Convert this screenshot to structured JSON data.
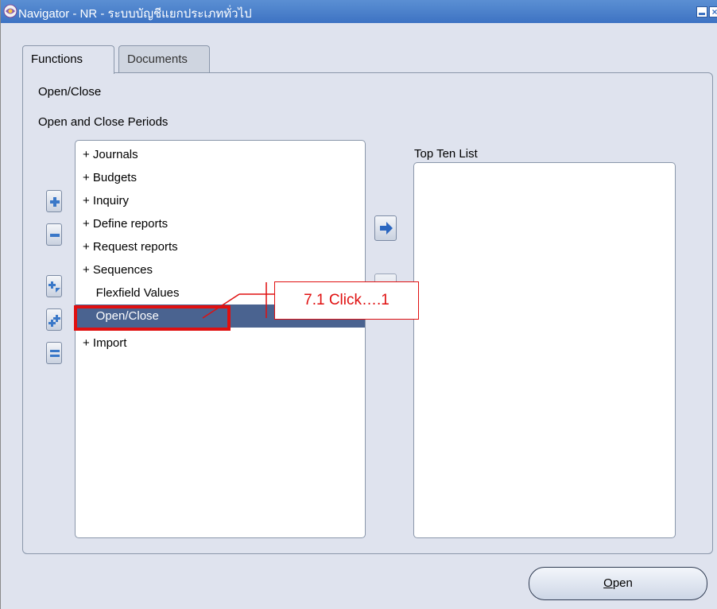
{
  "window": {
    "title": "Navigator - NR - ระบบบัญชีแยกประเภททั่วไป"
  },
  "tabs": [
    {
      "label": "Functions",
      "active": true
    },
    {
      "label": "Documents",
      "active": false
    }
  ],
  "selection": {
    "current_label": "Open/Close",
    "description": "Open and Close Periods"
  },
  "function_list": {
    "items": [
      {
        "label": "+  Journals"
      },
      {
        "label": "+  Budgets"
      },
      {
        "label": "+  Inquiry"
      },
      {
        "label": "+  Define reports"
      },
      {
        "label": "+  Request reports"
      },
      {
        "label": "+  Sequences"
      },
      {
        "label": "    Flexfield Values"
      },
      {
        "label": "    Open/Close",
        "selected": true
      },
      {
        "label": "+  Import"
      }
    ]
  },
  "top_ten": {
    "label": "Top Ten List"
  },
  "buttons": {
    "open_prefix": "O",
    "open_rest": "pen"
  },
  "annotation": {
    "callout_text": "7.1 Click….1",
    "color": "#e01010"
  },
  "colors": {
    "titlebar": "#3d73c3",
    "selected_row": "#4a6390",
    "panel_bg": "#dfe3ee"
  }
}
